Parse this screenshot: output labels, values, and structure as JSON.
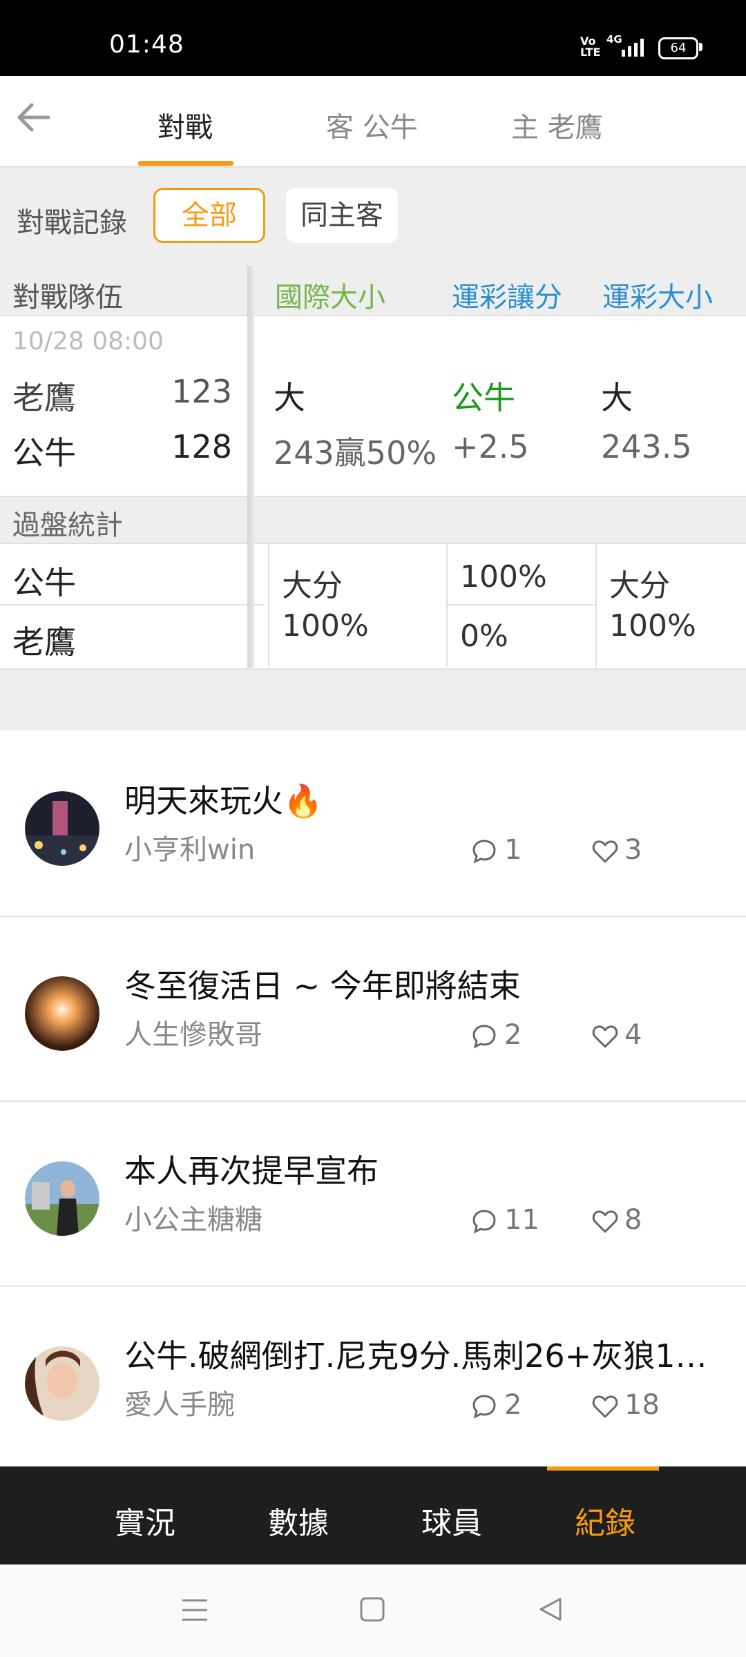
{
  "status_bar": {
    "time": "01:48",
    "volte": "Vo LTE",
    "network": "4G",
    "battery": "64"
  },
  "header": {
    "tabs": [
      {
        "label": "對戰",
        "active": true
      },
      {
        "label": "客 公牛",
        "active": false
      },
      {
        "label": "主 老鷹",
        "active": false
      }
    ]
  },
  "filter": {
    "label": "對戰記錄",
    "options": [
      {
        "label": "全部",
        "selected": true
      },
      {
        "label": "同主客",
        "selected": false
      }
    ]
  },
  "table": {
    "columns": {
      "team": "對戰隊伍",
      "intl_total": "國際大小",
      "lottery_spread": "運彩讓分",
      "lottery_total": "運彩大小"
    },
    "game": {
      "date": "10/28 08:00",
      "rows": [
        {
          "team": "老鷹",
          "score": "123",
          "intl_total": "大",
          "lottery_spread": "公牛",
          "lottery_total": "大"
        },
        {
          "team": "公牛",
          "score": "128",
          "intl_total": "243贏50%",
          "lottery_spread": "+2.5",
          "lottery_total": "243.5"
        }
      ]
    },
    "stats": {
      "label": "過盤統計",
      "teams": [
        "公牛",
        "老鷹"
      ],
      "intl_total": {
        "line1": "大分",
        "line2": "100%"
      },
      "lottery_spread": {
        "top": "100%",
        "bottom": "0%"
      },
      "lottery_total": {
        "line1": "大分",
        "line2": "100%"
      }
    }
  },
  "posts": [
    {
      "title": "明天來玩火🔥",
      "author": "小亨利win",
      "comments": "1",
      "likes": "3"
    },
    {
      "title": "冬至復活日 ~ 今年即將結束",
      "author": "人生慘敗哥",
      "comments": "2",
      "likes": "4"
    },
    {
      "title": "本人再次提早宣布",
      "author": "小公主糖糖",
      "comments": "11",
      "likes": "8"
    },
    {
      "title": "公牛.破網倒打.尼克9分.馬刺26+灰狼17...",
      "author": "愛人手腕",
      "comments": "2",
      "likes": "18"
    }
  ],
  "bottom_nav": {
    "items": [
      {
        "label": "實況",
        "active": false
      },
      {
        "label": "數據",
        "active": false
      },
      {
        "label": "球員",
        "active": false
      },
      {
        "label": "紀錄",
        "active": true
      }
    ]
  },
  "colors": {
    "accent": "#f39c12",
    "intl_green": "#73b54a",
    "lottery_blue": "#2a8fd0",
    "win_green": "#1a9a1a",
    "nav_bg": "#1e1e1e"
  },
  "icons": [
    "back-arrow-icon",
    "comment-icon",
    "heart-icon",
    "menu-icon",
    "home-square-icon",
    "back-triangle-icon"
  ]
}
